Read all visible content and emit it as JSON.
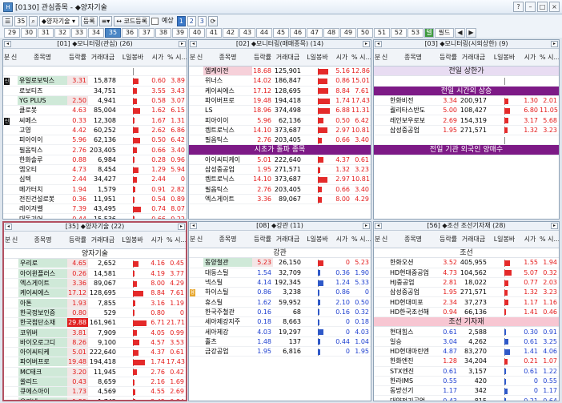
{
  "window": {
    "title": "[0130] 관심종목 - ◆양자기술",
    "icon_label": "H"
  },
  "toolbar": {
    "num": "35",
    "group": "◆양자기술",
    "register": "등록",
    "code_register": "코드등록",
    "forecast": "예상",
    "pages": [
      "1",
      "2",
      "3"
    ],
    "active_page": "1"
  },
  "tabs": [
    "29",
    "30",
    "31",
    "32",
    "33",
    "34",
    "35",
    "36",
    "37",
    "38",
    "39",
    "40",
    "41",
    "42",
    "43",
    "44",
    "45",
    "46",
    "47",
    "48",
    "49",
    "50",
    "51",
    "52",
    "53"
  ],
  "tab_active": "35",
  "tab_green": "텔",
  "tab_wide": "필드",
  "col_headers": {
    "a": "분",
    "b": "신",
    "name": "종목명",
    "pct": "등락률",
    "vol": "거래대금",
    "bar": "L일봉바",
    "r1": "시가",
    "r2": "% 시..."
  },
  "panels": [
    {
      "id": "p1",
      "title": "[01] ◆모니터링(관심) (26)",
      "rows": [
        {
          "name": "",
          "pct": "",
          "vol": "",
          "r1": "",
          "r2": "",
          "dir": "flat",
          "bar": 0
        },
        {
          "name": "유일로보틱스",
          "pct": "3.31",
          "vol": "15,878",
          "r1": "0.60",
          "r2": "3.89",
          "dir": "up",
          "bar": 0.4,
          "green": 1,
          "badge": "k"
        },
        {
          "name": "로보티즈",
          "pct": "",
          "vol": "34,751",
          "r1": "3.55",
          "r2": "3.43",
          "dir": "up",
          "bar": 0.3
        },
        {
          "name": "YG PLUS",
          "pct": "2.50",
          "vol": "4,941",
          "r1": "0.58",
          "r2": "3.07",
          "dir": "up",
          "bar": 0.3,
          "green": 1
        },
        {
          "name": "클로봇",
          "pct": "4.63",
          "vol": "85,004",
          "r1": "1.62",
          "r2": "6.15",
          "dir": "up",
          "bar": 0.5
        },
        {
          "name": "씨메스",
          "pct": "0.33",
          "vol": "12,308",
          "r1": "1.67",
          "r2": "1.31",
          "dir": "up",
          "bar": 0.1,
          "badge": "k"
        },
        {
          "name": "고영",
          "pct": "4.42",
          "vol": "60,252",
          "r1": "2.62",
          "r2": "6.86",
          "dir": "up",
          "bar": 0.4
        },
        {
          "name": "피아이이",
          "pct": "5.96",
          "vol": "62,136",
          "r1": "0.50",
          "r2": "6.42",
          "dir": "up",
          "bar": 0.5
        },
        {
          "name": "필옵틱스",
          "pct": "2.76",
          "vol": "203,405",
          "r1": "0.66",
          "r2": "3.40",
          "dir": "up",
          "bar": 0.3
        },
        {
          "name": "한화솔루",
          "pct": "0.88",
          "vol": "6,984",
          "r1": "0.28",
          "r2": "0.96",
          "dir": "up",
          "bar": 0.1
        },
        {
          "name": "엠오티",
          "pct": "4.73",
          "vol": "8,454",
          "r1": "1.29",
          "r2": "5.94",
          "dir": "up",
          "bar": 0.4
        },
        {
          "name": "심텍",
          "pct": "2.44",
          "vol": "34,427",
          "r1": "2.44",
          "r2": "0",
          "dir": "up",
          "bar": 0.3
        },
        {
          "name": "메가터치",
          "pct": "1.94",
          "vol": "1,579",
          "r1": "0.91",
          "r2": "2.82",
          "dir": "up",
          "bar": 0.2
        },
        {
          "name": "전진건설로봇",
          "pct": "0.36",
          "vol": "11,951",
          "r1": "0.54",
          "r2": "0.89",
          "dir": "up",
          "bar": 0.1
        },
        {
          "name": "레이저쎌",
          "pct": "7.39",
          "vol": "43,495",
          "r1": "0.74",
          "r2": "8.07",
          "dir": "up",
          "bar": 0.6
        },
        {
          "name": "대동기어",
          "pct": "0.44",
          "vol": "15,536",
          "r1": "0.66",
          "r2": "0.22",
          "dir": "up",
          "bar": 0.1
        }
      ]
    },
    {
      "id": "p2",
      "title": "[02] ◆모니터링(매매종목) (14)",
      "rows": [
        {
          "name": "엠케이전",
          "pct": "18.68",
          "vol": "125,901",
          "r1": "5.16",
          "r2": "12.86",
          "dir": "up",
          "bar": 0.8,
          "pink": 1
        },
        {
          "name": "위너스",
          "pct": "14.02",
          "vol": "186,847",
          "r1": "0.86",
          "r2": "15.01",
          "dir": "up",
          "bar": 0.7
        },
        {
          "name": "케이씨에스",
          "pct": "17.12",
          "vol": "128,695",
          "r1": "8.84",
          "r2": "7.61",
          "dir": "up",
          "bar": 0.8
        },
        {
          "name": "파이버프로",
          "pct": "19.48",
          "vol": "194,418",
          "r1": "1.74",
          "r2": "17.43",
          "dir": "up",
          "bar": 0.9
        },
        {
          "name": "LS",
          "pct": "18.96",
          "vol": "374,498",
          "r1": "6.88",
          "r2": "11.31",
          "dir": "up",
          "bar": 0.9
        },
        {
          "name": "피아이이",
          "pct": "5.96",
          "vol": "62,136",
          "r1": "0.50",
          "r2": "6.42",
          "dir": "up",
          "bar": 0.4
        },
        {
          "name": "켐트로닉스",
          "pct": "14.10",
          "vol": "373,687",
          "r1": "2.97",
          "r2": "10.81",
          "dir": "up",
          "bar": 0.7
        },
        {
          "name": "필옵틱스",
          "pct": "2.76",
          "vol": "203,405",
          "r1": "0.66",
          "r2": "3.40",
          "dir": "up",
          "bar": 0.3
        },
        {
          "sec": "시초가 돌파 종목",
          "style": "purple"
        },
        {
          "name": "아이씨티케이",
          "pct": "5.01",
          "vol": "222,640",
          "r1": "4.37",
          "r2": "0.61",
          "dir": "up",
          "bar": 0.4
        },
        {
          "name": "삼성중공업",
          "pct": "1.95",
          "vol": "271,571",
          "r1": "1.32",
          "r2": "3.23",
          "dir": "up",
          "bar": 0.2
        },
        {
          "name": "켐트로닉스",
          "pct": "14.10",
          "vol": "373,687",
          "r1": "2.97",
          "r2": "10.81",
          "dir": "up",
          "bar": 0.7
        },
        {
          "name": "필옵틱스",
          "pct": "2.76",
          "vol": "203,405",
          "r1": "0.66",
          "r2": "3.40",
          "dir": "up",
          "bar": 0.3
        },
        {
          "name": "엑스게이트",
          "pct": "3.36",
          "vol": "89,067",
          "r1": "8.00",
          "r2": "4.29",
          "dir": "up",
          "bar": 0.3
        }
      ]
    },
    {
      "id": "p3",
      "title": "[03] ◆모니터링(시외상한) (9)",
      "rows": [
        {
          "sec": "전일 상한가",
          "style": "lavender"
        },
        {
          "name": "",
          "pct": "",
          "vol": "",
          "r1": "",
          "r2": "",
          "dir": "flat",
          "bar": 0
        },
        {
          "sec": "전일 시간외 상승",
          "style": "purple"
        },
        {
          "name": "한화비전",
          "pct": "3.34",
          "vol": "200,917",
          "r1": "1.30",
          "r2": "2.01",
          "dir": "up",
          "bar": 0.3
        },
        {
          "name": "퀄리타스반도",
          "pct": "5.00",
          "vol": "108,427",
          "r1": "6.80",
          "r2": "11.05",
          "dir": "up",
          "bar": 0.4
        },
        {
          "name": "레인보우로보",
          "pct": "2.69",
          "vol": "154,319",
          "r1": "3.17",
          "r2": "5.68",
          "dir": "up",
          "bar": 0.3
        },
        {
          "name": "삼성중공업",
          "pct": "1.95",
          "vol": "271,571",
          "r1": "1.32",
          "r2": "3.23",
          "dir": "up",
          "bar": 0.2
        },
        {
          "name": "",
          "pct": "",
          "vol": "",
          "r1": "",
          "r2": "",
          "dir": "flat",
          "bar": 0
        },
        {
          "sec": "전일 기관 외국인 양매수",
          "style": "purple"
        }
      ]
    },
    {
      "id": "p4",
      "title": "[35] ◆양자기술 (22)",
      "rows": [
        {
          "sec": "양자기술",
          "style": "plain"
        },
        {
          "name": "우리로",
          "pct": "4.65",
          "vol": "2,652",
          "r1": "4.16",
          "r2": "0.45",
          "dir": "up",
          "bar": 0.4,
          "green": 1
        },
        {
          "name": "아이윈플러스",
          "pct": "0.26",
          "vol": "14,581",
          "r1": "4.19",
          "r2": "3.77",
          "dir": "up",
          "bar": 0.1,
          "green": 1
        },
        {
          "name": "엑스게이트",
          "pct": "3.36",
          "vol": "89,067",
          "r1": "8.00",
          "r2": "4.29",
          "dir": "up",
          "bar": 0.3,
          "green": 1
        },
        {
          "name": "케이씨에스",
          "pct": "17.12",
          "vol": "128,695",
          "r1": "8.84",
          "r2": "7.61",
          "dir": "up",
          "bar": 0.8,
          "green": 1
        },
        {
          "name": "아톤",
          "pct": "1.93",
          "vol": "7,855",
          "r1": "3.16",
          "r2": "1.19",
          "dir": "up",
          "bar": 0.2,
          "green": 1
        },
        {
          "name": "한국정보인증",
          "pct": "0.80",
          "vol": "529",
          "r1": "0.80",
          "r2": "0",
          "dir": "up",
          "bar": 0.1,
          "green": 1
        },
        {
          "name": "한국첨단소재",
          "pct": "29.88",
          "vol": "161,961",
          "r1": "6.71",
          "r2": "21.71",
          "dir": "up",
          "bar": 1.0,
          "green": 1,
          "hl": 1
        },
        {
          "name": "코위버",
          "pct": "3.81",
          "vol": "7,909",
          "r1": "4.05",
          "r2": "0.99",
          "dir": "up",
          "bar": 0.3,
          "green": 1
        },
        {
          "name": "바이오로그디",
          "pct": "8.26",
          "vol": "9,100",
          "r1": "4.57",
          "r2": "3.53",
          "dir": "up",
          "bar": 0.5,
          "green": 1
        },
        {
          "name": "아이씨티케",
          "pct": "5.01",
          "vol": "222,640",
          "r1": "4.37",
          "r2": "0.61",
          "dir": "up",
          "bar": 0.4,
          "green": 1
        },
        {
          "name": "파이버프로",
          "pct": "19.48",
          "vol": "194,418",
          "r1": "1.74",
          "r2": "17.43",
          "dir": "up",
          "bar": 0.9,
          "green": 1
        },
        {
          "name": "MC태크",
          "pct": "3.20",
          "vol": "11,945",
          "r1": "2.76",
          "r2": "0.42",
          "dir": "up",
          "bar": 0.3,
          "green": 1
        },
        {
          "name": "쏠리드",
          "pct": "0.43",
          "vol": "8,659",
          "r1": "2.16",
          "r2": "1.69",
          "dir": "up",
          "bar": 0.1,
          "green": 1
        },
        {
          "name": "큐에스아이",
          "pct": "1.73",
          "vol": "4,569",
          "r1": "4.55",
          "r2": "2.69",
          "dir": "up",
          "bar": 0.2,
          "green": 1
        },
        {
          "name": "우리넷",
          "pct": "1.59",
          "vol": "1,742",
          "r1": "2.45",
          "r2": "0.84",
          "dir": "up",
          "bar": 0.2,
          "green": 1
        }
      ]
    },
    {
      "id": "p5",
      "title": "[08] ◆강관 (11)",
      "rows": [
        {
          "sec": "강관",
          "style": "plain"
        },
        {
          "name": "동양철관",
          "pct": "5.23",
          "vol": "26,150",
          "r1": "0",
          "r2": "5.23",
          "dir": "up",
          "bar": 0.4,
          "green": 1
        },
        {
          "name": "대동스틸",
          "pct": "1.54",
          "vol": "32,709",
          "r1": "0.36",
          "r2": "1.90",
          "dir": "dn",
          "bar": 0.2
        },
        {
          "name": "넥스틸",
          "pct": "4.14",
          "vol": "192,345",
          "r1": "1.24",
          "r2": "5.33",
          "dir": "dn",
          "bar": 0.4
        },
        {
          "name": "하이스틸",
          "pct": "0.86",
          "vol": "3,238",
          "r1": "0.86",
          "r2": "0",
          "dir": "dn",
          "bar": 0.1,
          "badge": "y"
        },
        {
          "name": "휴스틸",
          "pct": "1.62",
          "vol": "59,952",
          "r1": "2.10",
          "r2": "0.50",
          "dir": "dn",
          "bar": 0.2
        },
        {
          "name": "한국주철관",
          "pct": "0.16",
          "vol": "68",
          "r1": "0.16",
          "r2": "0.32",
          "dir": "dn",
          "bar": 0.1
        },
        {
          "name": "세아제강지주",
          "pct": "0.18",
          "vol": "8,663",
          "r1": "0",
          "r2": "0.18",
          "dir": "dn",
          "bar": 0.1
        },
        {
          "name": "세아제강",
          "pct": "4.03",
          "vol": "19,297",
          "r1": "0",
          "r2": "4.03",
          "dir": "dn",
          "bar": 0.4
        },
        {
          "name": "홀츠",
          "pct": "1.48",
          "vol": "137",
          "r1": "0.44",
          "r2": "1.04",
          "dir": "dn",
          "bar": 0.2
        },
        {
          "name": "금강공업",
          "pct": "1.95",
          "vol": "6,816",
          "r1": "0",
          "r2": "1.95",
          "dir": "dn",
          "bar": 0.2
        }
      ]
    },
    {
      "id": "p6",
      "title": "[56] ◆조선 조선기자재 (28)",
      "rows": [
        {
          "sec": "조선",
          "style": "plain"
        },
        {
          "name": "한화오션",
          "pct": "3.52",
          "vol": "405,955",
          "r1": "1.55",
          "r2": "1.94",
          "dir": "up",
          "bar": 0.4
        },
        {
          "name": "HD현대중공업",
          "pct": "4.73",
          "vol": "104,562",
          "r1": "5.07",
          "r2": "0.32",
          "dir": "up",
          "bar": 0.5
        },
        {
          "name": "HJ중공업",
          "pct": "2.81",
          "vol": "18,022",
          "r1": "0.77",
          "r2": "2.03",
          "dir": "up",
          "bar": 0.3
        },
        {
          "name": "삼성중공업",
          "pct": "1.95",
          "vol": "271,571",
          "r1": "1.32",
          "r2": "3.23",
          "dir": "up",
          "bar": 0.2
        },
        {
          "name": "HD현대미포",
          "pct": "2.34",
          "vol": "37,273",
          "r1": "1.17",
          "r2": "1.16",
          "dir": "up",
          "bar": 0.3
        },
        {
          "name": "HD한국조선해",
          "pct": "0.94",
          "vol": "66,136",
          "r1": "1.41",
          "r2": "0.46",
          "dir": "up",
          "bar": 0.1
        },
        {
          "sec": "조선 기자재",
          "style": "pink"
        },
        {
          "name": "현대힘스",
          "pct": "0.61",
          "vol": "2,588",
          "r1": "0.30",
          "r2": "0.91",
          "dir": "dn",
          "bar": 0.1
        },
        {
          "name": "일승",
          "pct": "3.04",
          "vol": "4,262",
          "r1": "0.61",
          "r2": "3.25",
          "dir": "dn",
          "bar": 0.3
        },
        {
          "name": "HD현대마린엔",
          "pct": "4.87",
          "vol": "83,270",
          "r1": "1.41",
          "r2": "4.06",
          "dir": "dn",
          "bar": 0.4
        },
        {
          "name": "한화엔진",
          "pct": "1.28",
          "vol": "34,204",
          "r1": "0.21",
          "r2": "1.07",
          "dir": "up",
          "bar": 0.2
        },
        {
          "name": "STX엔진",
          "pct": "0.61",
          "vol": "3,157",
          "r1": "0.61",
          "r2": "1.22",
          "dir": "dn",
          "bar": 0.1
        },
        {
          "name": "한라IMS",
          "pct": "0.55",
          "vol": "420",
          "r1": "0",
          "r2": "0.55",
          "dir": "dn",
          "bar": 0.1
        },
        {
          "name": "동방선기",
          "pct": "1.17",
          "vol": "342",
          "r1": "0",
          "r2": "1.17",
          "dir": "dn",
          "bar": 0.2
        },
        {
          "name": "대양전기공업",
          "pct": "0.43",
          "vol": "815",
          "r1": "0.21",
          "r2": "0.64",
          "dir": "dn",
          "bar": 0.1
        }
      ]
    }
  ]
}
